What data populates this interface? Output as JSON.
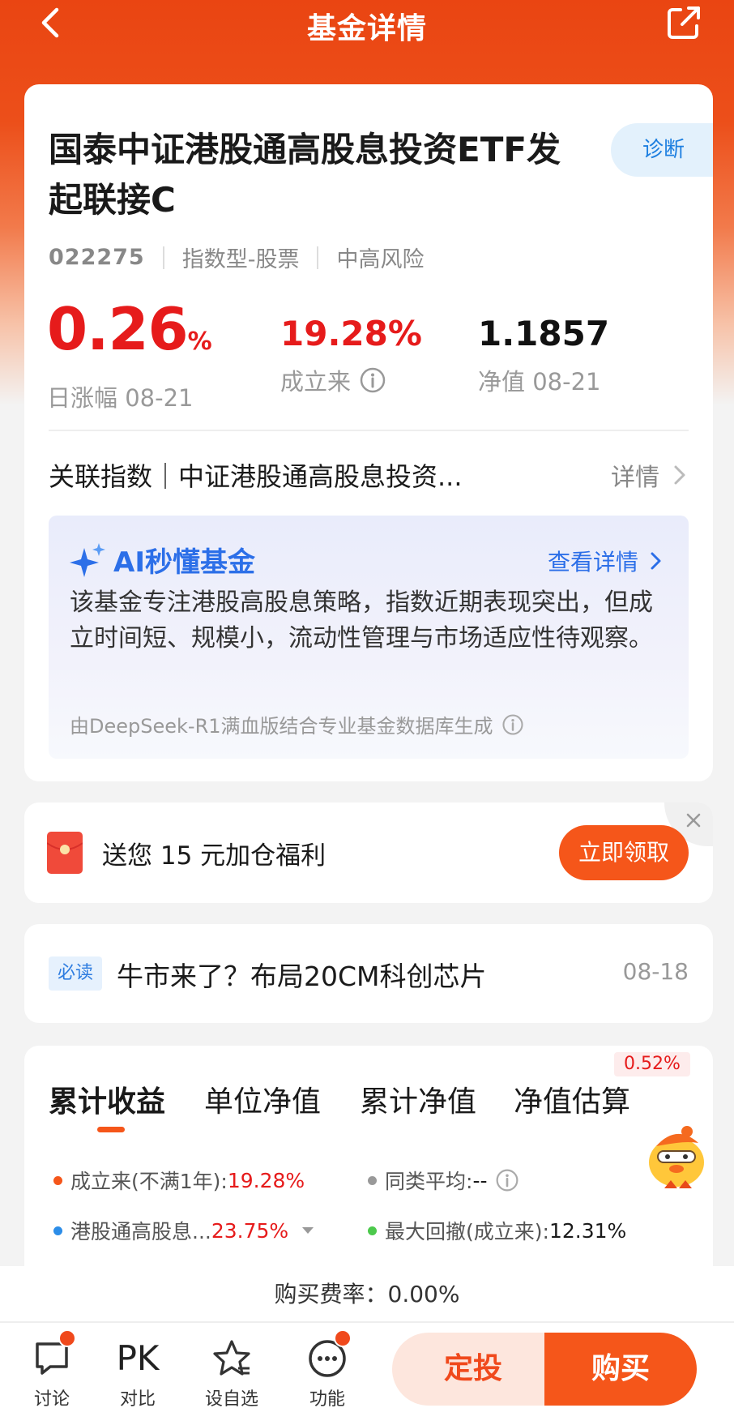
{
  "header": {
    "title": "基金详情"
  },
  "fund": {
    "name": "国泰中证港股通高股息投资ETF发起联接C",
    "diagnose_label": "诊断",
    "code": "022275",
    "type": "指数型-股票",
    "risk": "中高风险"
  },
  "stats": {
    "daily_change_value": "0.26",
    "daily_change_unit": "%",
    "daily_change_label": "日涨幅 08-21",
    "since_inception_value": "19.28%",
    "since_inception_label": "成立来",
    "nav_value": "1.1857",
    "nav_label": "净值 08-21"
  },
  "related_index": {
    "text": "关联指数｜中证港股通高股息投资...",
    "detail_label": "详情"
  },
  "ai_summary": {
    "title": "AI秒懂基金",
    "link_label": "查看详情",
    "body": "该基金专注港股高股息策略，指数近期表现突出，但成立时间短、规模小，流动性管理与市场适应性待观察。",
    "footer": "由DeepSeek-R1满血版结合专业基金数据库生成"
  },
  "promo": {
    "text": "送您 15 元加仓福利",
    "button_label": "立即领取"
  },
  "news": {
    "tag": "必读",
    "title": "牛市来了？布局20CM科创芯片",
    "date": "08-18"
  },
  "tabs": {
    "items": [
      "累计收益",
      "单位净值",
      "累计净值",
      "净值估算"
    ],
    "active_index": 0,
    "estimate_badge": "0.52%"
  },
  "legend": {
    "inception_label": "成立来(不满1年):",
    "inception_value": "19.28%",
    "peer_avg_label": "同类平均:",
    "peer_avg_value": "--",
    "index_label": "港股通高股息...",
    "index_value": "23.75%",
    "max_drawdown_label": "最大回撤(成立来):",
    "max_drawdown_value": "12.31%"
  },
  "fee": {
    "text": "购买费率：0.00%"
  },
  "bottom_nav": {
    "discuss": "讨论",
    "compare": "对比",
    "compare_glyph": "PK",
    "watchlist": "设自选",
    "functions": "功能",
    "sip_button": "定投",
    "buy_button": "购买"
  },
  "colors": {
    "brand_orange": "#f5561a",
    "rise_red": "#e61b1b",
    "ai_blue": "#2c6fe8"
  }
}
